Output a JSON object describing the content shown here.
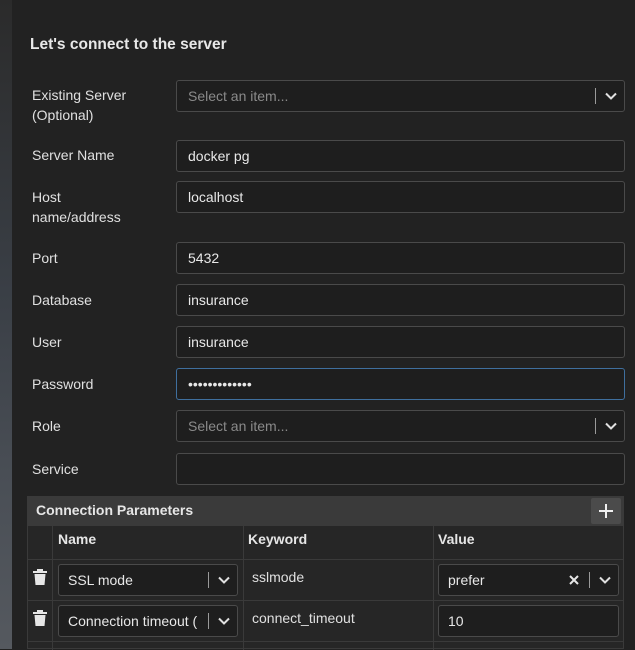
{
  "form": {
    "title": "Let's connect to the server",
    "existing_server": {
      "label_line1": "Existing Server",
      "label_line2": "(Optional)",
      "placeholder": "Select an item..."
    },
    "server_name": {
      "label": "Server Name",
      "value": "docker pg"
    },
    "host": {
      "label_line1": "Host",
      "label_line2": "name/address",
      "value": "localhost"
    },
    "port": {
      "label": "Port",
      "value": "5432"
    },
    "database": {
      "label": "Database",
      "value": "insurance"
    },
    "user": {
      "label": "User",
      "value": "insurance"
    },
    "password": {
      "label": "Password",
      "masked": "•••••••••••••"
    },
    "role": {
      "label": "Role",
      "placeholder": "Select an item..."
    },
    "service": {
      "label": "Service",
      "value": ""
    }
  },
  "connection_parameters": {
    "title": "Connection Parameters",
    "columns": [
      "Name",
      "Keyword",
      "Value"
    ],
    "rows": [
      {
        "name": "SSL mode",
        "keyword": "sslmode",
        "value": "prefer"
      },
      {
        "name": "Connection timeout (",
        "keyword": "connect_timeout",
        "value": "10"
      }
    ]
  },
  "icons": [
    "chevron-down-icon",
    "plus-icon",
    "trash-icon",
    "clear-icon"
  ],
  "colors": {
    "background": "#222222",
    "field_bg": "#1e1e1e",
    "focus_border": "#3f6f9e",
    "header_bg": "#3a3a3a"
  }
}
